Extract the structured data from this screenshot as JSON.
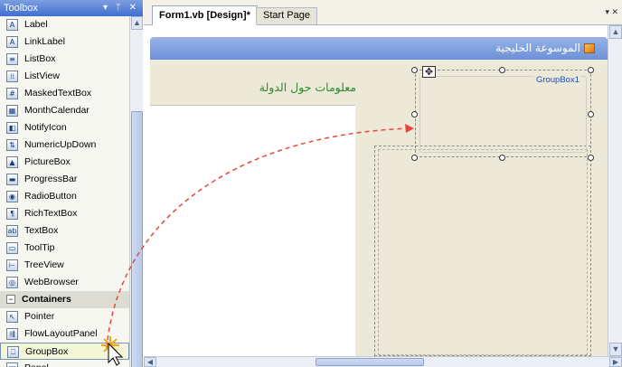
{
  "toolbox": {
    "title": "Toolbox",
    "controls": "▾ ᛘ ✕",
    "items": [
      {
        "label": "Label",
        "icon": "label-icon",
        "glyph": "A"
      },
      {
        "label": "LinkLabel",
        "icon": "linklabel-icon",
        "glyph": "A"
      },
      {
        "label": "ListBox",
        "icon": "listbox-icon",
        "glyph": "≡"
      },
      {
        "label": "ListView",
        "icon": "listview-icon",
        "glyph": "⁞⁞"
      },
      {
        "label": "MaskedTextBox",
        "icon": "maskedtextbox-icon",
        "glyph": "#"
      },
      {
        "label": "MonthCalendar",
        "icon": "monthcalendar-icon",
        "glyph": "▦"
      },
      {
        "label": "NotifyIcon",
        "icon": "notifyicon-icon",
        "glyph": "◧"
      },
      {
        "label": "NumericUpDown",
        "icon": "numericupdown-icon",
        "glyph": "⇅"
      },
      {
        "label": "PictureBox",
        "icon": "picturebox-icon",
        "glyph": "▲"
      },
      {
        "label": "ProgressBar",
        "icon": "progressbar-icon",
        "glyph": "▬"
      },
      {
        "label": "RadioButton",
        "icon": "radiobutton-icon",
        "glyph": "◉"
      },
      {
        "label": "RichTextBox",
        "icon": "richtextbox-icon",
        "glyph": "¶"
      },
      {
        "label": "TextBox",
        "icon": "textbox-icon",
        "glyph": "ab"
      },
      {
        "label": "ToolTip",
        "icon": "tooltip-icon",
        "glyph": "▭"
      },
      {
        "label": "TreeView",
        "icon": "treeview-icon",
        "glyph": "⊢"
      },
      {
        "label": "WebBrowser",
        "icon": "webbrowser-icon",
        "glyph": "◎"
      }
    ],
    "category": {
      "label": "Containers",
      "expander": "−"
    },
    "container_items": [
      {
        "label": "Pointer",
        "icon": "pointer-icon",
        "glyph": "↖"
      },
      {
        "label": "FlowLayoutPanel",
        "icon": "flowlayoutpanel-icon",
        "glyph": "⇶"
      },
      {
        "label": "GroupBox",
        "icon": "groupbox-icon",
        "glyph": "⎕"
      },
      {
        "label": "Panel",
        "icon": "panel-icon",
        "glyph": "□"
      }
    ]
  },
  "tabs": {
    "design": "Form1.vb [Design]*",
    "start": "Start Page",
    "menu_glyph": "▾ ✕"
  },
  "form": {
    "title": "الموسوعة الخليجية",
    "heading": "معلومات حول الدولة",
    "groupbox_label": "GroupBox1",
    "move_glyph": "✥"
  },
  "colors": {
    "toolbox_title": "#3f6fd1",
    "form_title": "#6d90d8",
    "heading": "#2e8b2e",
    "groupbox_label": "#1d4fb8",
    "drag_arrow": "#e8463a"
  }
}
